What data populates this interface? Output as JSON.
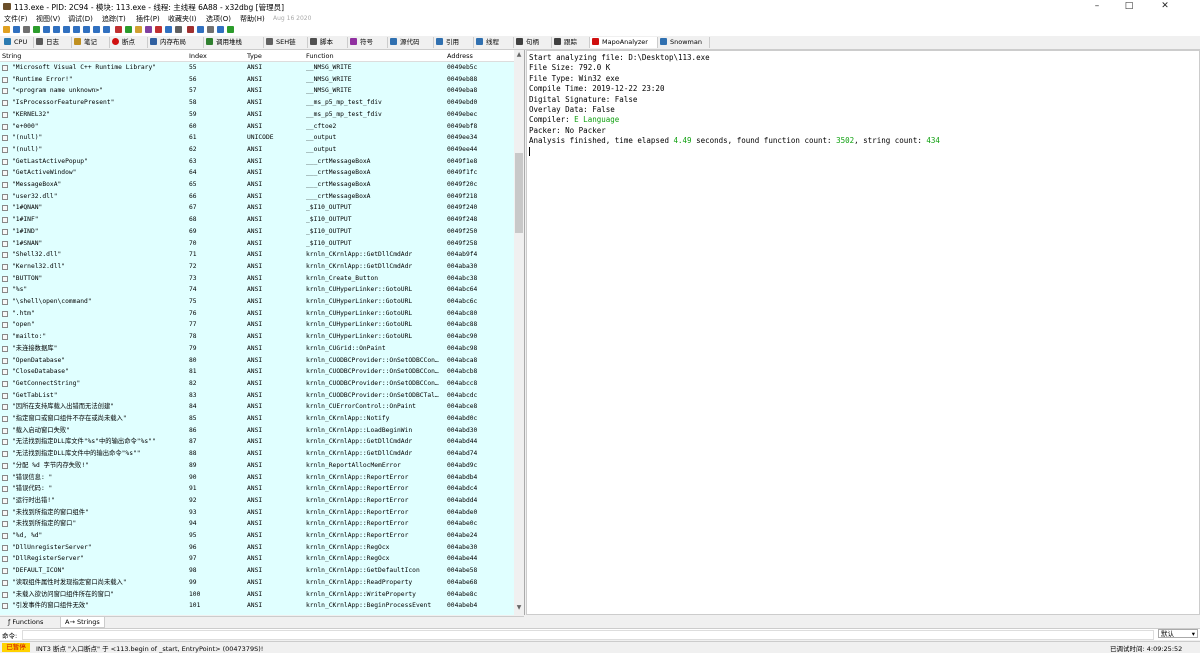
{
  "window": {
    "title": "113.exe - PID: 2C94 - 模块: 113.exe - 线程: 主线程 6A88 - x32dbg [管理员]"
  },
  "menu": {
    "items": [
      "文件(F)",
      "视图(V)",
      "调试(D)",
      "追踪(T)",
      "插件(P)",
      "收藏夹(I)",
      "选项(O)",
      "帮助(H)"
    ],
    "date": "Aug 16 2020"
  },
  "tabs": [
    {
      "label": "CPU",
      "icon": "cpu-icon",
      "color": "#2a7ab0"
    },
    {
      "label": "日志",
      "icon": "log-icon",
      "color": "#5a5a5a"
    },
    {
      "label": "笔记",
      "icon": "notes-icon",
      "color": "#c09020"
    },
    {
      "label": "断点",
      "icon": "breakpoint-icon",
      "color": "#d01010"
    },
    {
      "label": "内存布局",
      "icon": "memory-icon",
      "color": "#3060a0"
    },
    {
      "label": "调用堆栈",
      "icon": "callstack-icon",
      "color": "#308030"
    },
    {
      "label": "SEH链",
      "icon": "seh-icon",
      "color": "#606060"
    },
    {
      "label": "脚本",
      "icon": "script-icon",
      "color": "#505050"
    },
    {
      "label": "符号",
      "icon": "symbol-icon",
      "color": "#9030a0"
    },
    {
      "label": "源代码",
      "icon": "source-icon",
      "color": "#3070b0"
    },
    {
      "label": "引用",
      "icon": "references-icon",
      "color": "#3070b0"
    },
    {
      "label": "线程",
      "icon": "threads-icon",
      "color": "#3070b0"
    },
    {
      "label": "句柄",
      "icon": "handles-icon",
      "color": "#404040"
    },
    {
      "label": "跟踪",
      "icon": "trace-icon",
      "color": "#404040"
    },
    {
      "label": "MapoAnalyzer",
      "icon": "mapo-icon",
      "color": "#d01010"
    },
    {
      "label": "Snowman",
      "icon": "snowman-icon",
      "color": "#3070b0"
    }
  ],
  "table": {
    "headers": [
      "String",
      "Index",
      "Type",
      "Function",
      "Address"
    ],
    "rows": [
      [
        "\"Microsoft Visual C++ Runtime Library\"",
        "55",
        "ANSI",
        "__NMSG_WRITE",
        "0049eb5c"
      ],
      [
        "\"Runtime Error!\"",
        "56",
        "ANSI",
        "__NMSG_WRITE",
        "0049eb88"
      ],
      [
        "\"<program name unknown>\"",
        "57",
        "ANSI",
        "__NMSG_WRITE",
        "0049eba8"
      ],
      [
        "\"IsProcessorFeaturePresent\"",
        "58",
        "ANSI",
        "__ms_p5_mp_test_fdiv",
        "0049ebd0"
      ],
      [
        "\"KERNEL32\"",
        "59",
        "ANSI",
        "__ms_p5_mp_test_fdiv",
        "0049ebec"
      ],
      [
        "\"e+000\"",
        "60",
        "ANSI",
        "__cftoe2",
        "0049ebf8"
      ],
      [
        "\"(null)\"",
        "61",
        "UNICODE",
        "__output",
        "0049ee34"
      ],
      [
        "\"(null)\"",
        "62",
        "ANSI",
        "__output",
        "0049ee44"
      ],
      [
        "\"GetLastActivePopup\"",
        "63",
        "ANSI",
        "___crtMessageBoxA",
        "0049f1e8"
      ],
      [
        "\"GetActiveWindow\"",
        "64",
        "ANSI",
        "___crtMessageBoxA",
        "0049f1fc"
      ],
      [
        "\"MessageBoxA\"",
        "65",
        "ANSI",
        "___crtMessageBoxA",
        "0049f20c"
      ],
      [
        "\"user32.dll\"",
        "66",
        "ANSI",
        "___crtMessageBoxA",
        "0049f218"
      ],
      [
        "\"1#QNAN\"",
        "67",
        "ANSI",
        "_$I10_OUTPUT",
        "0049f240"
      ],
      [
        "\"1#INF\"",
        "68",
        "ANSI",
        "_$I10_OUTPUT",
        "0049f248"
      ],
      [
        "\"1#IND\"",
        "69",
        "ANSI",
        "_$I10_OUTPUT",
        "0049f250"
      ],
      [
        "\"1#SNAN\"",
        "70",
        "ANSI",
        "_$I10_OUTPUT",
        "0049f258"
      ],
      [
        "\"Shell32.dll\"",
        "71",
        "ANSI",
        "krnln_CKrnlApp::GetDllCmdAdr",
        "004ab9f4"
      ],
      [
        "\"Kernel32.dll\"",
        "72",
        "ANSI",
        "krnln_CKrnlApp::GetDllCmdAdr",
        "004aba30"
      ],
      [
        "\"BUTTON\"",
        "73",
        "ANSI",
        "krnln_Create_Button",
        "004abc38"
      ],
      [
        "\"%s\"",
        "74",
        "ANSI",
        "krnln_CUHyperLinker::GotoURL",
        "004abc64"
      ],
      [
        "\"\\shell\\open\\command\"",
        "75",
        "ANSI",
        "krnln_CUHyperLinker::GotoURL",
        "004abc6c"
      ],
      [
        "\".htm\"",
        "76",
        "ANSI",
        "krnln_CUHyperLinker::GotoURL",
        "004abc80"
      ],
      [
        "\"open\"",
        "77",
        "ANSI",
        "krnln_CUHyperLinker::GotoURL",
        "004abc88"
      ],
      [
        "\"mailto:\"",
        "78",
        "ANSI",
        "krnln_CUHyperLinker::GotoURL",
        "004abc90"
      ],
      [
        "\"未连接数据库\"",
        "79",
        "ANSI",
        "krnln_CUGrid::OnPaint",
        "004abc98"
      ],
      [
        "\"OpenDatabase\"",
        "80",
        "ANSI",
        "krnln_CUODBCProvider::OnSetODBCCon…",
        "004abca8"
      ],
      [
        "\"CloseDatabase\"",
        "81",
        "ANSI",
        "krnln_CUODBCProvider::OnSetODBCCon…",
        "004abcb8"
      ],
      [
        "\"GetConnectString\"",
        "82",
        "ANSI",
        "krnln_CUODBCProvider::OnSetODBCCon…",
        "004abcc8"
      ],
      [
        "\"GetTabList\"",
        "83",
        "ANSI",
        "krnln_CUODBCProvider::OnSetODBCTal…",
        "004abcdc"
      ],
      [
        "\"因所在支持库载入出错而无法创建\"",
        "84",
        "ANSI",
        "krnln_CUErrorControl::OnPaint",
        "004abce8"
      ],
      [
        "\"指定窗口或窗口组件不存在或尚未载入\"",
        "85",
        "ANSI",
        "krnln_CKrnlApp::Notify",
        "004abd0c"
      ],
      [
        "\"载入启动窗口失败\"",
        "86",
        "ANSI",
        "krnln_CKrnlApp::LoadBeginWin",
        "004abd30"
      ],
      [
        "\"无法找到指定DLL库文件\"%s\"中的输出命令\"%s\"\"",
        "87",
        "ANSI",
        "krnln_CKrnlApp::GetDllCmdAdr",
        "004abd44"
      ],
      [
        "\"无法找到指定DLL库文件中的输出命令\"%s\"\"",
        "88",
        "ANSI",
        "krnln_CKrnlApp::GetDllCmdAdr",
        "004abd74"
      ],
      [
        "\"分配 %d 字节内存失败!\"",
        "89",
        "ANSI",
        "krnln_ReportAllocMemError",
        "004abd9c"
      ],
      [
        "\"错误信息: \"",
        "90",
        "ANSI",
        "krnln_CKrnlApp::ReportError",
        "004abdb4"
      ],
      [
        "\"错误代码: \"",
        "91",
        "ANSI",
        "krnln_CKrnlApp::ReportError",
        "004abdc4"
      ],
      [
        "\"运行时出错!\"",
        "92",
        "ANSI",
        "krnln_CKrnlApp::ReportError",
        "004abdd4"
      ],
      [
        "\"未找到所指定的窗口组件\"",
        "93",
        "ANSI",
        "krnln_CKrnlApp::ReportError",
        "004abde0"
      ],
      [
        "\"未找到所指定的窗口\"",
        "94",
        "ANSI",
        "krnln_CKrnlApp::ReportError",
        "004abe0c"
      ],
      [
        "\"%d, %d\"",
        "95",
        "ANSI",
        "krnln_CKrnlApp::ReportError",
        "004abe24"
      ],
      [
        "\"DllUnregisterServer\"",
        "96",
        "ANSI",
        "krnln_CKrnlApp::RegOcx",
        "004abe30"
      ],
      [
        "\"DllRegisterServer\"",
        "97",
        "ANSI",
        "krnln_CKrnlApp::RegOcx",
        "004abe44"
      ],
      [
        "\"DEFAULT_ICON\"",
        "98",
        "ANSI",
        "krnln_CKrnlApp::GetDefaultIcon",
        "004abe58"
      ],
      [
        "\"读取组件属性时发现指定窗口尚未载入\"",
        "99",
        "ANSI",
        "krnln_CKrnlApp::ReadProperty",
        "004abe68"
      ],
      [
        "\"未载入欲访问窗口组件所在的窗口\"",
        "100",
        "ANSI",
        "krnln_CKrnlApp::WriteProperty",
        "004abe8c"
      ],
      [
        "\"引发事件的窗口组件无效\"",
        "101",
        "ANSI",
        "krnln_CKrnlApp::BeginProcessEvent",
        "004abeb4"
      ]
    ]
  },
  "output": {
    "lines": [
      {
        "text": "Start analyzing file: D:\\Desktop\\113.exe"
      },
      {
        "text": "File Size: 792.0 K"
      },
      {
        "text": "File Type: Win32 exe"
      },
      {
        "text": "Compile Time: 2019-12-22 23:20"
      },
      {
        "text": "Digital Signature: False"
      },
      {
        "text": "Overlay Data: False"
      },
      {
        "prefix": "Compiler: ",
        "highlight": "E Language"
      },
      {
        "text": "Packer: No Packer"
      }
    ],
    "final": {
      "p1": "Analysis finished, time elapsed ",
      "v1": "4.49",
      "p2": " seconds, found function count: ",
      "v2": "3502",
      "p3": ", string count: ",
      "v3": "434"
    }
  },
  "bottom_tabs": [
    "Functions",
    "Strings"
  ],
  "command": {
    "label": "命令:",
    "mode": "默认"
  },
  "status": {
    "state": "已暂停",
    "message": "INT3 断点 \"入口断点\" 于 <113.begin of _start, EntryPoint> (0047379S)!",
    "time": "已调试时间: 4:09:25:52"
  },
  "colors": {
    "table_bg": "#e0ffff",
    "highlight": "#10a010",
    "paused_bg": "#ffd200"
  }
}
